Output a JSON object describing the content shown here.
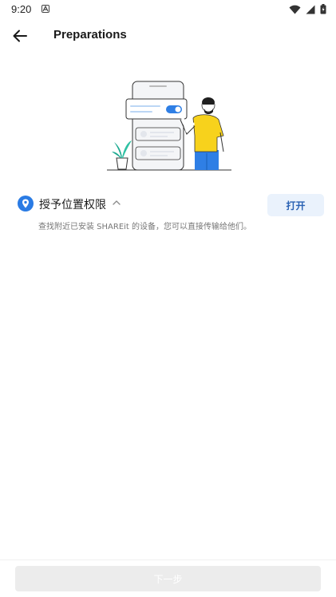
{
  "status_bar": {
    "time": "9:20",
    "icons": [
      "app-notification-icon",
      "wifi-icon",
      "signal-icon",
      "battery-icon"
    ]
  },
  "toolbar": {
    "back_icon": "arrow-left-icon",
    "title": "Preparations"
  },
  "permission": {
    "icon": "location-pin-icon",
    "title": "授予位置权限",
    "expand_icon": "chevron-up-icon",
    "button_label": "打开",
    "description": "查找附近已安装 SHAREit 的设备，您可以直接传输给他们。"
  },
  "footer": {
    "next_label": "下一步",
    "next_enabled": false
  },
  "colors": {
    "accent": "#2a7be4",
    "button_text": "#2a62b4",
    "button_bg": "#eaf2fc",
    "disabled_bg": "#ececec",
    "illustration_yellow": "#f7d21c",
    "illustration_blue": "#2f7fe5"
  }
}
